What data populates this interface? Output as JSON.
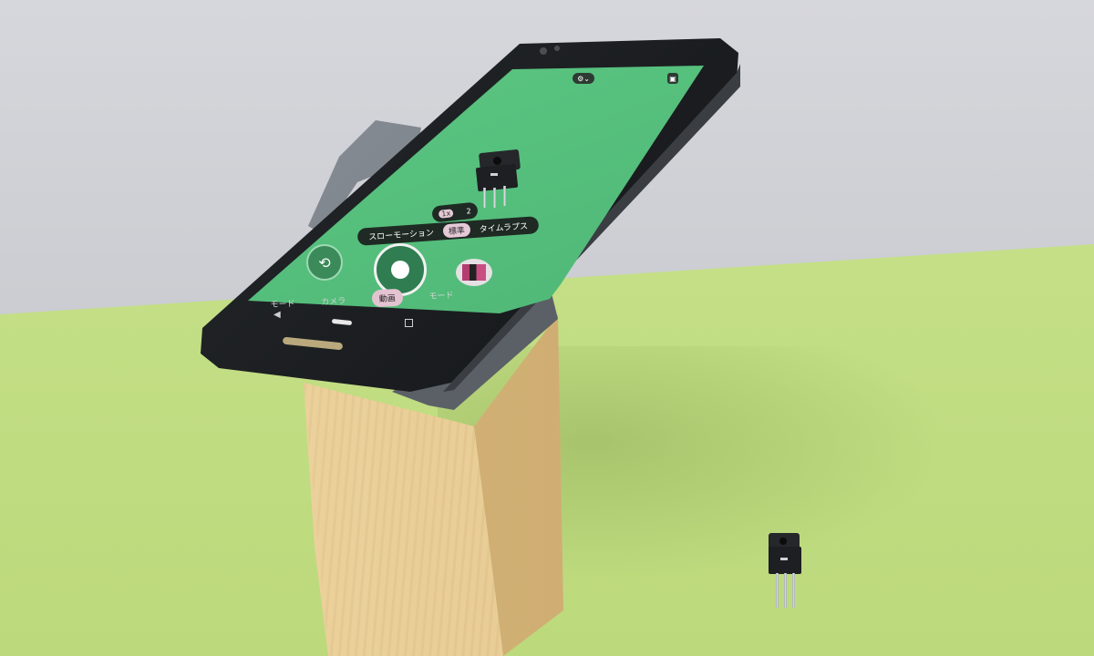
{
  "camera_ui": {
    "zoom_values": [
      "1x",
      "2"
    ],
    "speed_options": [
      "スローモーション",
      "標準",
      "タイムラプス"
    ],
    "speed_selected": "標準",
    "modes": [
      "モード",
      "カメラ",
      "動画",
      "モード"
    ],
    "mode_selected": "動画",
    "top_settings_icon": "settings-chevron-icon",
    "top_right_icon": "gallery-icon"
  },
  "colors": {
    "screen_green": "#5fcb86",
    "selection_pink": "#e6c9d6",
    "floor_green": "#c4df86",
    "wall_grey": "#cfd1d5",
    "wood": "#e9cd96",
    "holder_grey": "#5b6066"
  }
}
